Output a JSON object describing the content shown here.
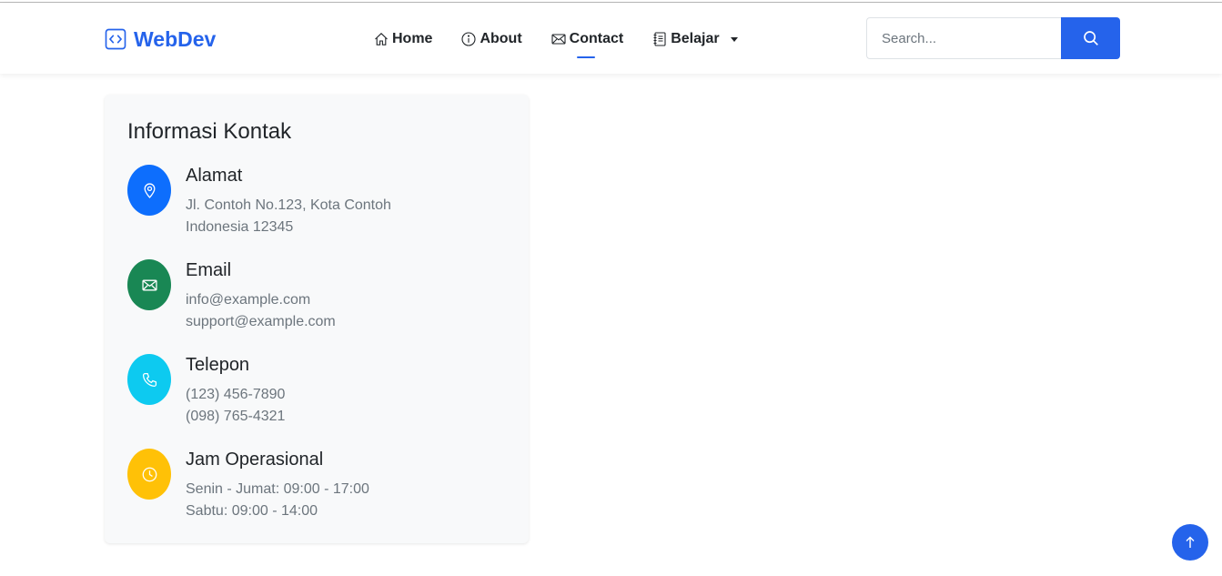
{
  "brand": {
    "name": "WebDev",
    "icon": "code-square-icon",
    "color": "#2563eb"
  },
  "nav": {
    "items": [
      {
        "label": "Home",
        "icon": "house-icon"
      },
      {
        "label": "About",
        "icon": "info-circle-icon"
      },
      {
        "label": "Contact",
        "icon": "envelope-icon",
        "active": true
      },
      {
        "label": "Belajar",
        "icon": "journal-icon",
        "dropdown": true
      }
    ]
  },
  "search": {
    "placeholder": "Search...",
    "value": "",
    "button_icon": "search-icon"
  },
  "contact_card": {
    "title": "Informasi Kontak",
    "items": [
      {
        "title": "Alamat",
        "icon": "geo-alt-icon",
        "color": "#0d6efd",
        "lines": [
          "Jl. Contoh No.123, Kota Contoh",
          "Indonesia 12345"
        ]
      },
      {
        "title": "Email",
        "icon": "envelope-icon",
        "color": "#198754",
        "lines": [
          "info@example.com",
          "support@example.com"
        ]
      },
      {
        "title": "Telepon",
        "icon": "telephone-icon",
        "color": "#0dcaf0",
        "lines": [
          "(123) 456-7890",
          "(098) 765-4321"
        ]
      },
      {
        "title": "Jam Operasional",
        "icon": "clock-icon",
        "color": "#ffc107",
        "lines": [
          "Senin - Jumat: 09:00 - 17:00",
          "Sabtu: 09:00 - 14:00"
        ]
      }
    ]
  },
  "back_to_top": {
    "icon": "arrow-up-icon",
    "color": "#2563eb"
  }
}
